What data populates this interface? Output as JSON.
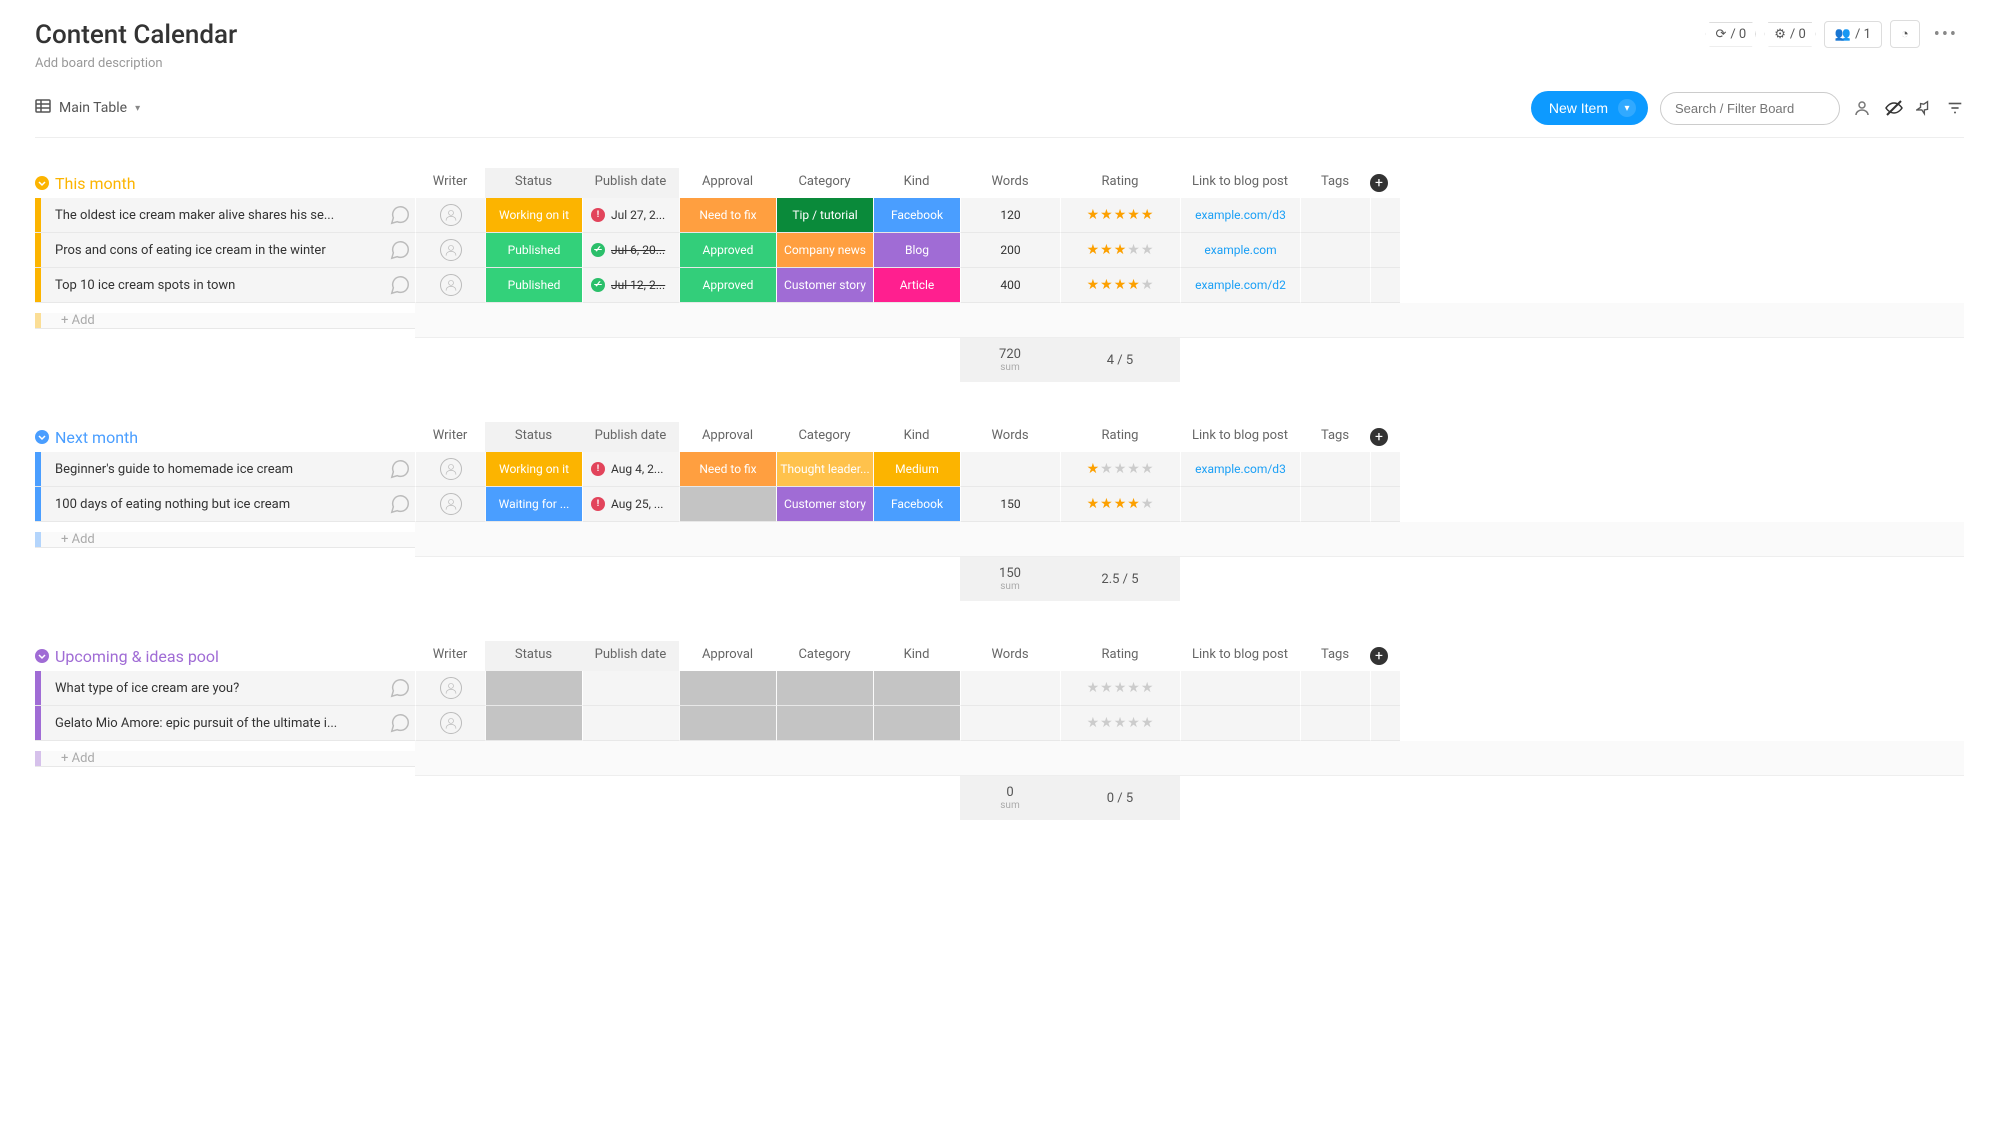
{
  "header": {
    "title": "Content Calendar",
    "subtitle": "Add board description",
    "badges": {
      "b1": "/ 0",
      "b2": "/ 0",
      "b3": "/ 1"
    }
  },
  "toolbar": {
    "view_label": "Main Table",
    "new_item_label": "New Item",
    "search_placeholder": "Search / Filter Board"
  },
  "columns": {
    "writer": "Writer",
    "status": "Status",
    "publish": "Publish date",
    "approval": "Approval",
    "category": "Category",
    "kind": "Kind",
    "words": "Words",
    "rating": "Rating",
    "link": "Link to blog post",
    "tags": "Tags"
  },
  "colors": {
    "working": "#fcb400",
    "published": "#33d17a",
    "waiting": "#4a9eff",
    "needfix": "#ff9f40",
    "approved": "#33ce7a",
    "tip": "#0a8a3a",
    "company": "#ff9f40",
    "customer": "#a06cd5",
    "thought": "#ffc24c",
    "facebook": "#4a9eff",
    "blog": "#a06cd5",
    "article": "#ff1f8f",
    "medium": "#fcb400",
    "grey": "#c4c4c4",
    "date_red": "#e2445b",
    "date_green": "#2bbf6a",
    "g1": "#fcb400",
    "g2": "#4a9eff",
    "g3": "#a06cd5"
  },
  "groups": [
    {
      "name": "This month",
      "color_key": "g1",
      "rows": [
        {
          "name": "The oldest ice cream maker alive shares his se...",
          "status": "Working on it",
          "status_key": "working",
          "publish": "Jul 27, 2...",
          "date_key": "date_red",
          "strike": false,
          "approval": "Need to fix",
          "approval_key": "needfix",
          "category": "Tip / tutorial",
          "category_key": "tip",
          "kind": "Facebook",
          "kind_key": "facebook",
          "words": "120",
          "rating": 5,
          "link": "example.com/d3"
        },
        {
          "name": "Pros and cons of eating ice cream in the winter",
          "status": "Published",
          "status_key": "published",
          "publish": "Jul 6, 20...",
          "date_key": "date_green",
          "strike": true,
          "approval": "Approved",
          "approval_key": "approved",
          "category": "Company news",
          "category_key": "company",
          "kind": "Blog",
          "kind_key": "blog",
          "words": "200",
          "rating": 3,
          "link": "example.com"
        },
        {
          "name": "Top 10 ice cream spots in town",
          "status": "Published",
          "status_key": "published",
          "publish": "Jul 12, 2...",
          "date_key": "date_green",
          "strike": true,
          "approval": "Approved",
          "approval_key": "approved",
          "category": "Customer story",
          "category_key": "customer",
          "kind": "Article",
          "kind_key": "article",
          "words": "400",
          "rating": 4,
          "link": "example.com/d2"
        }
      ],
      "add_label": "+ Add",
      "summary": {
        "words": "720",
        "words_sub": "sum",
        "rating": "4 / 5"
      }
    },
    {
      "name": "Next month",
      "color_key": "g2",
      "rows": [
        {
          "name": "Beginner's guide to homemade ice cream",
          "status": "Working on it",
          "status_key": "working",
          "publish": "Aug 4, 2...",
          "date_key": "date_red",
          "strike": false,
          "approval": "Need to fix",
          "approval_key": "needfix",
          "category": "Thought leader...",
          "category_key": "thought",
          "kind": "Medium",
          "kind_key": "medium",
          "words": "",
          "rating": 1,
          "link": "example.com/d3"
        },
        {
          "name": "100 days of eating nothing but ice cream",
          "status": "Waiting for ...",
          "status_key": "waiting",
          "publish": "Aug 25, ...",
          "date_key": "date_red",
          "strike": false,
          "approval": "",
          "approval_key": "grey",
          "category": "Customer story",
          "category_key": "customer",
          "kind": "Facebook",
          "kind_key": "facebook",
          "words": "150",
          "rating": 4,
          "link": ""
        }
      ],
      "add_label": "+ Add",
      "summary": {
        "words": "150",
        "words_sub": "sum",
        "rating": "2.5 / 5"
      }
    },
    {
      "name": "Upcoming & ideas pool",
      "color_key": "g3",
      "rows": [
        {
          "name": "What type of ice cream are you?",
          "status": "",
          "status_key": "grey",
          "publish": "",
          "date_key": "",
          "strike": false,
          "approval": "",
          "approval_key": "grey",
          "category": "",
          "category_key": "grey",
          "kind": "",
          "kind_key": "grey",
          "words": "",
          "rating": 0,
          "link": ""
        },
        {
          "name": "Gelato Mio Amore: epic pursuit of the ultimate i...",
          "status": "",
          "status_key": "grey",
          "publish": "",
          "date_key": "",
          "strike": false,
          "approval": "",
          "approval_key": "grey",
          "category": "",
          "category_key": "grey",
          "kind": "",
          "kind_key": "grey",
          "words": "",
          "rating": 0,
          "link": ""
        }
      ],
      "add_label": "+ Add",
      "summary": {
        "words": "0",
        "words_sub": "sum",
        "rating": "0 / 5"
      }
    }
  ]
}
